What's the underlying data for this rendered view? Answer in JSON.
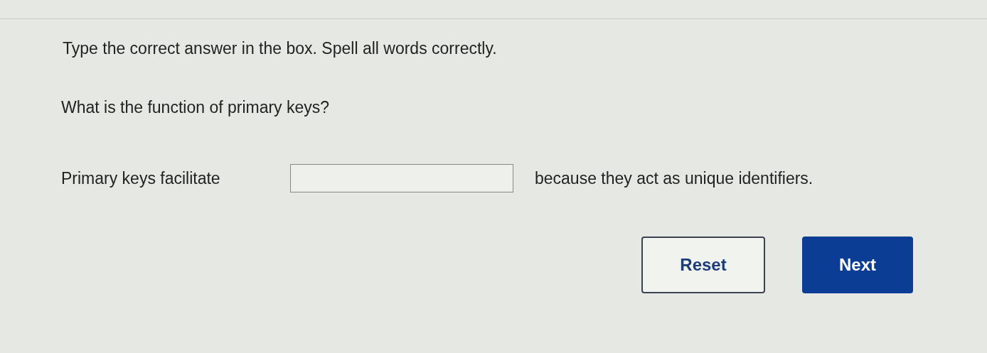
{
  "instruction": "Type the correct answer in the box. Spell all words correctly.",
  "question": "What is the function of primary keys?",
  "sentence": {
    "before": "Primary keys facilitate",
    "after": "because they act as unique identifiers."
  },
  "buttons": [
    {
      "label": "Reset",
      "kind": "secondary"
    },
    {
      "label": "Next",
      "kind": "primary"
    }
  ]
}
